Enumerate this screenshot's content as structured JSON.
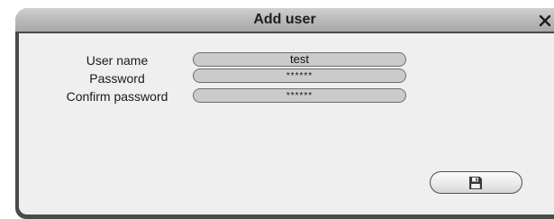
{
  "dialog": {
    "title": "Add user",
    "close_icon": "close-icon",
    "fields": [
      {
        "label": "User name",
        "value": "test",
        "masked": false
      },
      {
        "label": "Password",
        "value": "******",
        "masked": true
      },
      {
        "label": "Confirm password",
        "value": "******",
        "masked": true
      }
    ],
    "save_button": {
      "icon": "save-icon"
    }
  },
  "colors": {
    "frame": "#4a4a4a",
    "titlebar": "#bcbcbc",
    "content_bg": "#efefef",
    "field_bg": "#cbcbcb"
  }
}
